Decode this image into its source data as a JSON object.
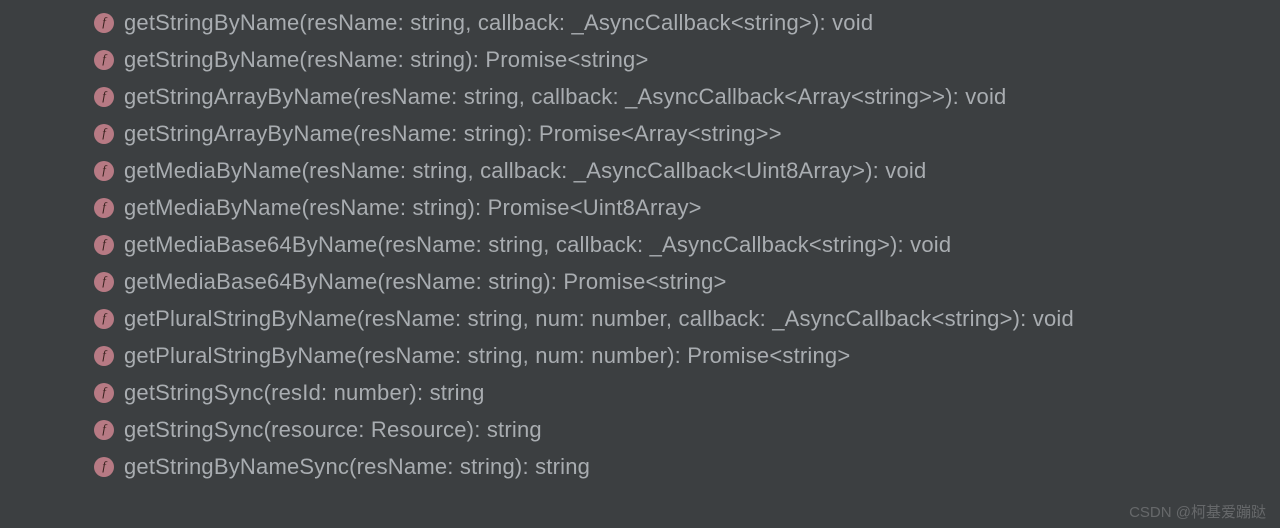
{
  "icon_letter": "f",
  "watermark": "CSDN @柯基爱蹦跶",
  "items": [
    {
      "signature": "getStringByName(resName: string, callback: _AsyncCallback<string>): void"
    },
    {
      "signature": "getStringByName(resName: string): Promise<string>"
    },
    {
      "signature": "getStringArrayByName(resName: string, callback: _AsyncCallback<Array<string>>): void"
    },
    {
      "signature": "getStringArrayByName(resName: string): Promise<Array<string>>"
    },
    {
      "signature": "getMediaByName(resName: string, callback: _AsyncCallback<Uint8Array>): void"
    },
    {
      "signature": "getMediaByName(resName: string): Promise<Uint8Array>"
    },
    {
      "signature": "getMediaBase64ByName(resName: string, callback: _AsyncCallback<string>): void"
    },
    {
      "signature": "getMediaBase64ByName(resName: string): Promise<string>"
    },
    {
      "signature": "getPluralStringByName(resName: string, num: number, callback: _AsyncCallback<string>): void"
    },
    {
      "signature": "getPluralStringByName(resName: string, num: number): Promise<string>"
    },
    {
      "signature": "getStringSync(resId: number): string"
    },
    {
      "signature": "getStringSync(resource: Resource): string"
    },
    {
      "signature": "getStringByNameSync(resName: string): string"
    }
  ]
}
